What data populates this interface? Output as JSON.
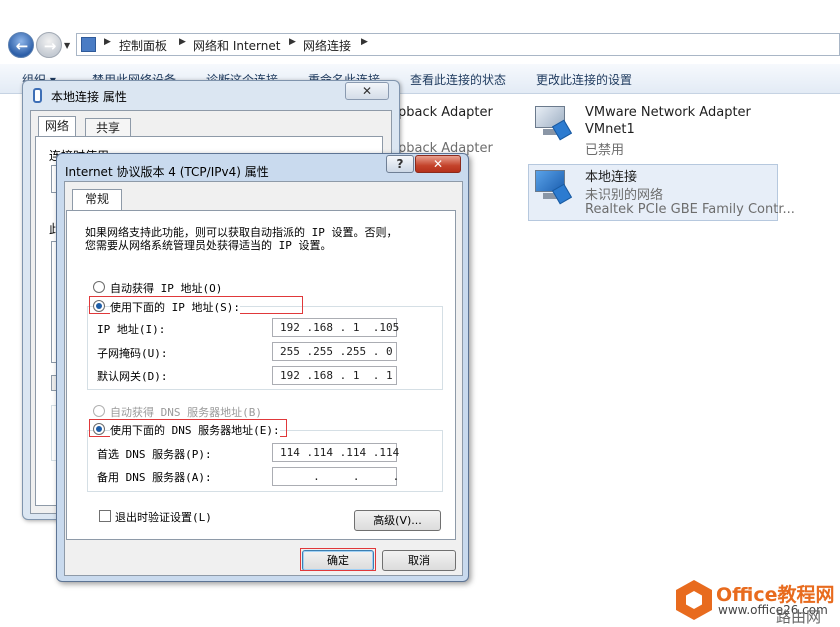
{
  "explorer": {
    "breadcrumb": [
      "控制面板",
      "网络和 Internet",
      "网络连接"
    ],
    "toolbar": [
      "组织 ▾",
      "禁用此网络设备",
      "诊断这个连接",
      "重命名此连接",
      "查看此连接的状态",
      "更改此连接的设置"
    ]
  },
  "adapters": {
    "loopback1_name": "pback Adapter",
    "loopback2_name": "pback Adapter",
    "vmware": {
      "name": "VMware Network Adapter",
      "sub": "VMnet1",
      "status": "已禁用"
    },
    "local": {
      "name": "本地连接",
      "status": "未识别的网络",
      "device": "Realtek PCIe GBE Family Contr..."
    }
  },
  "props_dialog": {
    "title": "本地连接 属性",
    "close": "✕",
    "tabs": [
      "网络",
      "共享"
    ],
    "connect_using_fragment": "连接时使用:",
    "item_fragment": "此"
  },
  "ipv4_dialog": {
    "title": "Internet 协议版本 4 (TCP/IPv4) 属性",
    "help": "?",
    "close": "✕",
    "tab": "常规",
    "description_line1": "如果网络支持此功能，则可以获取自动指派的 IP 设置。否则，",
    "description_line2": "您需要从网络系统管理员处获得适当的 IP 设置。",
    "auto_ip": "自动获得 IP 地址(O)",
    "manual_ip": "使用下面的 IP 地址(S):",
    "ip_label": "IP 地址(I):",
    "ip_value": "192 .168 . 1  .105",
    "mask_label": "子网掩码(U):",
    "mask_value": "255 .255 .255 . 0",
    "gateway_label": "默认网关(D):",
    "gateway_value": "192 .168 . 1  . 1",
    "auto_dns": "自动获得 DNS 服务器地址(B)",
    "manual_dns": "使用下面的 DNS 服务器地址(E):",
    "dns1_label": "首选 DNS 服务器(P):",
    "dns1_value": "114 .114 .114 .114",
    "dns2_label": "备用 DNS 服务器(A):",
    "dns2_value": "     .     .     .",
    "validate": "退出时验证设置(L)",
    "advanced": "高级(V)...",
    "ok": "确定",
    "cancel": "取消"
  },
  "watermark": {
    "brand": "Office教程网",
    "url": "www.office26.com",
    "corner": "路由网"
  }
}
